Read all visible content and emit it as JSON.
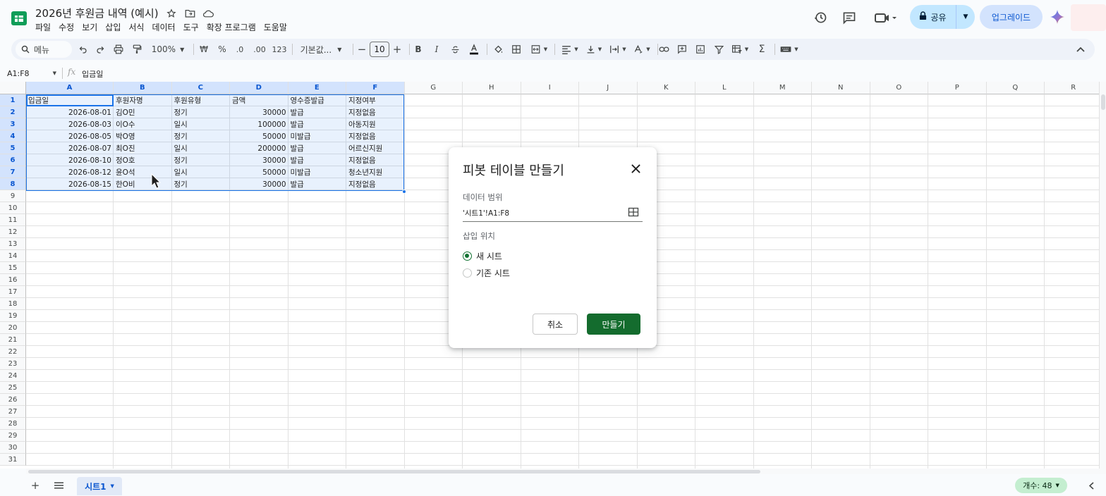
{
  "doc_title": "2026년 후원금 내역 (예시)",
  "menus": [
    "파일",
    "수정",
    "보기",
    "삽입",
    "서식",
    "데이터",
    "도구",
    "확장 프로그램",
    "도움말"
  ],
  "share_label": "공유",
  "upgrade_label": "업그레이드",
  "toolbar": {
    "menu_search": "메뉴",
    "zoom": "100%",
    "currency": "₩",
    "percent": "%",
    "dec_decrease": ".0",
    "dec_increase": ".00",
    "number_format": "123",
    "font": "기본값...",
    "font_size": "10",
    "bold": "B",
    "italic": "I"
  },
  "formula_bar": {
    "name_box": "A1:F8",
    "fx": "fx",
    "content": "입금일"
  },
  "columns": [
    "A",
    "B",
    "C",
    "D",
    "E",
    "F",
    "G",
    "H",
    "I",
    "J",
    "K",
    "L",
    "M",
    "N",
    "O",
    "P",
    "Q",
    "R"
  ],
  "row_numbers": [
    "1",
    "2",
    "3",
    "4",
    "5",
    "6",
    "7",
    "8",
    "9",
    "10",
    "11",
    "12",
    "13",
    "14",
    "15",
    "16",
    "17",
    "18",
    "19",
    "20",
    "21",
    "22",
    "23",
    "24",
    "25",
    "26",
    "27",
    "28",
    "29",
    "30",
    "31"
  ],
  "table": {
    "headers": [
      "입금일",
      "후원자명",
      "후원유형",
      "금액",
      "영수증발급",
      "지정여부"
    ],
    "rows": [
      [
        "2026-08-01",
        "김O민",
        "정기",
        "30000",
        "발급",
        "지정없음"
      ],
      [
        "2026-08-03",
        "이O수",
        "일시",
        "100000",
        "발급",
        "아동지원"
      ],
      [
        "2026-08-05",
        "박O영",
        "정기",
        "50000",
        "미발급",
        "지정없음"
      ],
      [
        "2026-08-07",
        "최O진",
        "일시",
        "200000",
        "발급",
        "어르신지원"
      ],
      [
        "2026-08-10",
        "정O호",
        "정기",
        "30000",
        "발급",
        "지정없음"
      ],
      [
        "2026-08-12",
        "윤O석",
        "일시",
        "50000",
        "미발급",
        "청소년지원"
      ],
      [
        "2026-08-15",
        "한O비",
        "정기",
        "30000",
        "발급",
        "지정없음"
      ]
    ]
  },
  "dialog": {
    "title": "피봇 테이블 만들기",
    "range_label": "데이터 범위",
    "range_value": "'시트1'!A1:F8",
    "insert_label": "삽입 위치",
    "option_new": "새 시트",
    "option_existing": "기존 시트",
    "cancel": "취소",
    "create": "만들기"
  },
  "sheet_tab": "시트1",
  "count_label": "개수: 48",
  "colors": {
    "accent_green": "#146c2e",
    "selection_blue": "#1a73e8",
    "share_bg": "#c2e7ff",
    "count_bg": "#c4eed0"
  }
}
